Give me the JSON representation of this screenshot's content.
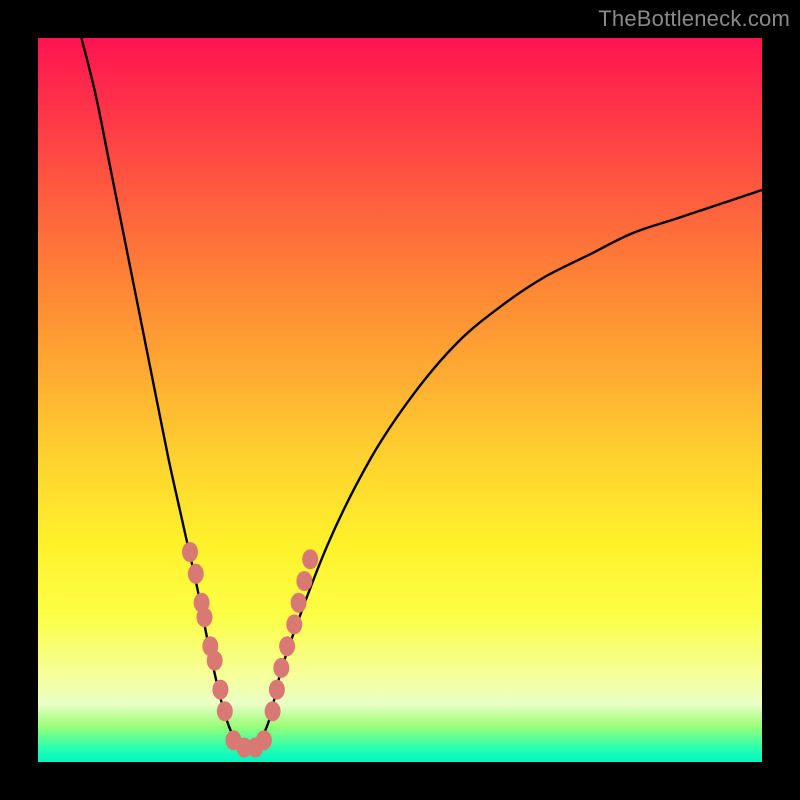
{
  "watermark": "TheBottleneck.com",
  "chart_data": {
    "type": "line",
    "title": "",
    "xlabel": "",
    "ylabel": "",
    "xlim": [
      0,
      100
    ],
    "ylim": [
      0,
      100
    ],
    "series": [
      {
        "name": "bottleneck-curve",
        "x": [
          6,
          8,
          10,
          12,
          14,
          16,
          18,
          20,
          22,
          24,
          26,
          28,
          30,
          32,
          34,
          40,
          46,
          52,
          58,
          64,
          70,
          76,
          82,
          88,
          94,
          100
        ],
        "values": [
          100,
          92,
          82,
          72,
          62,
          52,
          42,
          33,
          24,
          14,
          6,
          2,
          2,
          6,
          14,
          30,
          42,
          51,
          58,
          63,
          67,
          70,
          73,
          75,
          77,
          79
        ]
      }
    ],
    "markers": {
      "name": "highlight-points",
      "color": "#d87a73",
      "points": [
        {
          "x": 21.0,
          "y": 29
        },
        {
          "x": 21.8,
          "y": 26
        },
        {
          "x": 22.6,
          "y": 22
        },
        {
          "x": 23.0,
          "y": 20
        },
        {
          "x": 23.8,
          "y": 16
        },
        {
          "x": 24.4,
          "y": 14
        },
        {
          "x": 25.2,
          "y": 10
        },
        {
          "x": 25.8,
          "y": 7
        },
        {
          "x": 27.0,
          "y": 3
        },
        {
          "x": 28.5,
          "y": 2
        },
        {
          "x": 30.0,
          "y": 2
        },
        {
          "x": 31.2,
          "y": 3
        },
        {
          "x": 32.4,
          "y": 7
        },
        {
          "x": 33.0,
          "y": 10
        },
        {
          "x": 33.6,
          "y": 13
        },
        {
          "x": 34.4,
          "y": 16
        },
        {
          "x": 35.4,
          "y": 19
        },
        {
          "x": 36.0,
          "y": 22
        },
        {
          "x": 36.8,
          "y": 25
        },
        {
          "x": 37.6,
          "y": 28
        }
      ]
    }
  }
}
